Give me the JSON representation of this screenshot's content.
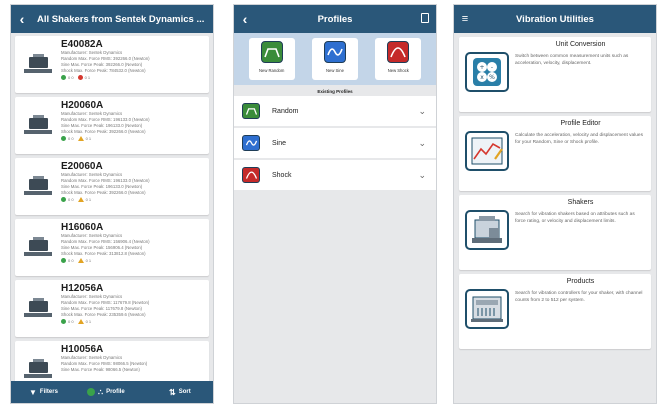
{
  "colors": {
    "header": "#2a5779",
    "background": "#e7e8ea",
    "green": "#3aa24a",
    "red": "#d5382f",
    "amber": "#e2a424"
  },
  "shakers_screen": {
    "title": "All Shakers from Sentek Dynamics ...",
    "back_icon": "back-arrow-icon",
    "items": [
      {
        "model": "E40082A",
        "manufacturer": "Manufacturer: Sentek Dynamics",
        "random": "Random Max. Force RMS: 392266.0 (Newton)",
        "sine": "Sine Max. Force Peak: 392266.0 (Newton)",
        "shock": "Shock Max. Force Peak: 784532.0 (Newton)",
        "status_good": "0 0",
        "status_alert": "0 1",
        "alert_type": "error"
      },
      {
        "model": "H20060A",
        "manufacturer": "Manufacturer: Sentek Dynamics",
        "random": "Random Max. Force RMS: 196133.0 (Newton)",
        "sine": "Sine Max. Force Peak: 196133.0 (Newton)",
        "shock": "Shock Max. Force Peak: 392266.0 (Newton)",
        "status_good": "0 0",
        "status_alert": "0 1",
        "alert_type": "warning"
      },
      {
        "model": "E20060A",
        "manufacturer": "Manufacturer: Sentek Dynamics",
        "random": "Random Max. Force RMS: 196133.0 (Newton)",
        "sine": "Sine Max. Force Peak: 196133.0 (Newton)",
        "shock": "Shock Max. Force Peak: 392266.0 (Newton)",
        "status_good": "0 0",
        "status_alert": "0 1",
        "alert_type": "warning"
      },
      {
        "model": "H16060A",
        "manufacturer": "Manufacturer: Sentek Dynamics",
        "random": "Random Max. Force RMS: 156906.4 (Newton)",
        "sine": "Sine Max. Force Peak: 156906.4 (Newton)",
        "shock": "Shock Max. Force Peak: 313812.8 (Newton)",
        "status_good": "0 0",
        "status_alert": "0 1",
        "alert_type": "warning"
      },
      {
        "model": "H12056A",
        "manufacturer": "Manufacturer: Sentek Dynamics",
        "random": "Random Max. Force RMS: 117679.8 (Newton)",
        "sine": "Sine Max. Force Peak: 117679.8 (Newton)",
        "shock": "Shock Max. Force Peak: 235359.6 (Newton)",
        "status_good": "0 0",
        "status_alert": "0 1",
        "alert_type": "warning"
      },
      {
        "model": "H10056A",
        "manufacturer": "Manufacturer: Sentek Dynamics",
        "random": "Random Max. Force RMS: 98066.5 (Newton)",
        "sine": "Sine Max. Force Peak: 98066.5 (Newton)",
        "shock": "",
        "status_good": "",
        "status_alert": "",
        "alert_type": "none"
      }
    ],
    "footer": {
      "filters": "Filters",
      "profile_badge": "1",
      "profile": "Profile",
      "sort": "Sort"
    }
  },
  "profiles_screen": {
    "title": "Profiles",
    "tiles": [
      {
        "label": "New Random",
        "icon": "random-profile-icon"
      },
      {
        "label": "New Sine",
        "icon": "sine-profile-icon"
      },
      {
        "label": "New Shock",
        "icon": "shock-profile-icon"
      }
    ],
    "existing_label": "Existing Profiles",
    "rows": [
      {
        "label": "Random",
        "icon": "random-profile-icon"
      },
      {
        "label": "Sine",
        "icon": "sine-profile-icon"
      },
      {
        "label": "Shock",
        "icon": "shock-profile-icon"
      }
    ]
  },
  "utilities_screen": {
    "title": "Vibration Utilities",
    "menu_icon": "hamburger-menu-icon",
    "cards": [
      {
        "title": "Unit Conversion",
        "desc": "Switch between common measurement units such as acceleration, velocity, displacement.",
        "icon": "calculator-icon"
      },
      {
        "title": "Profile Editor",
        "desc": "Calculate the acceleration, velocity and displacement values for your Random, Sine or Shock profile.",
        "icon": "profile-editor-icon"
      },
      {
        "title": "Shakers",
        "desc": "Search for vibration shakers based on attributes such as force rating, or velocity and displacement limits.",
        "icon": "shaker-icon"
      },
      {
        "title": "Products",
        "desc": "Search for vibration controllers for your shaker, with channel counts from 2 to 512 per system.",
        "icon": "controller-product-icon"
      }
    ]
  }
}
